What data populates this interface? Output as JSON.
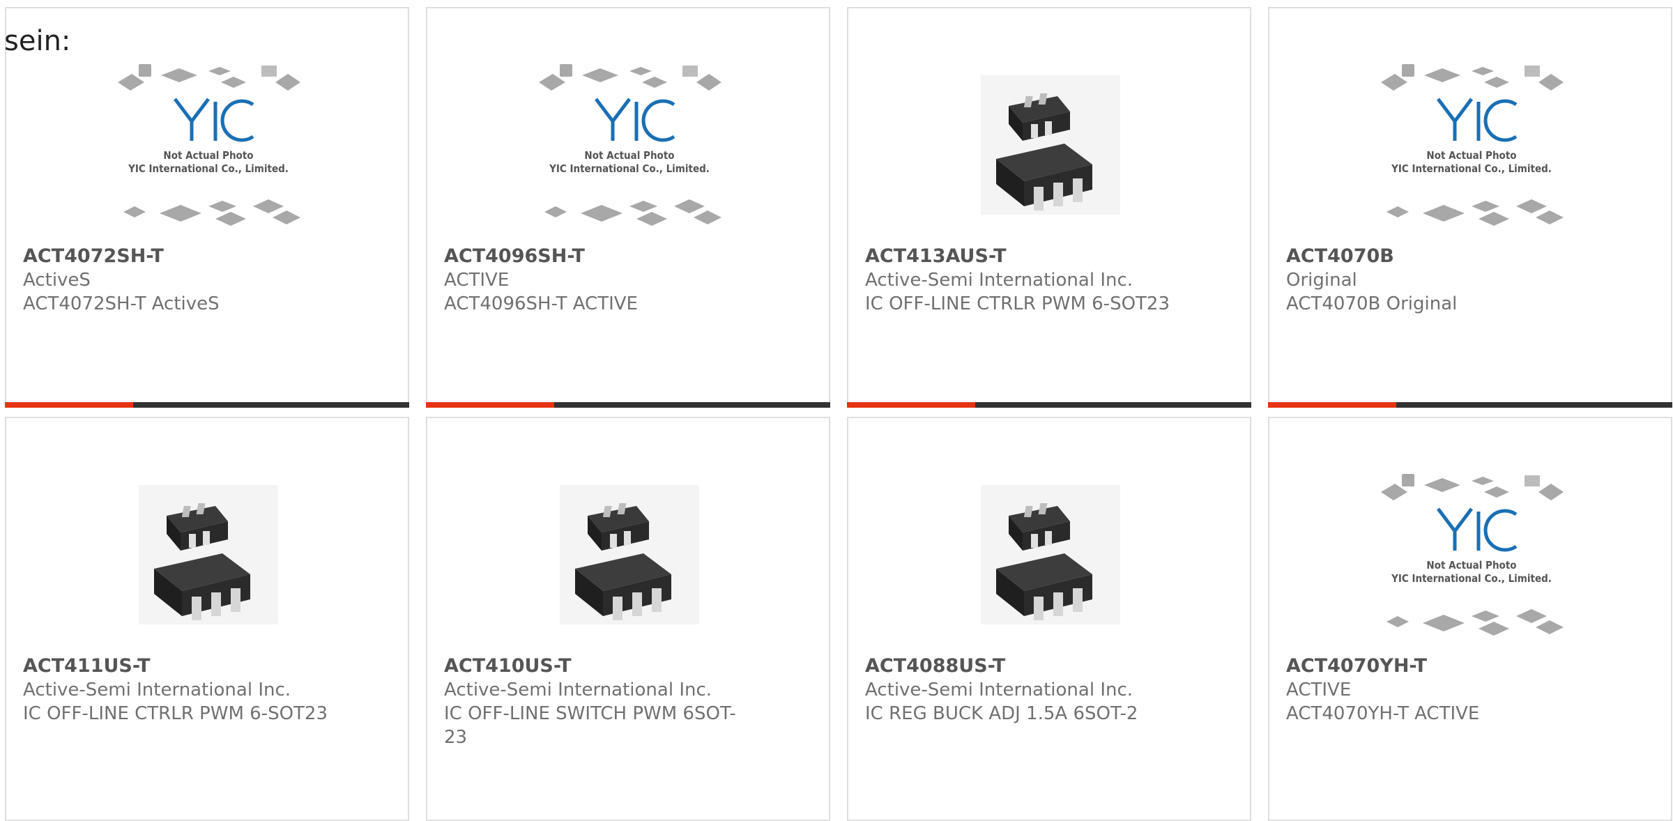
{
  "lead_text": "sein:",
  "colors": {
    "accent": "#e63312",
    "bar": "#333333"
  },
  "placeholder_image": {
    "caption_line1": "Not Actual Photo",
    "caption_line2": "YIC International Co., Limited.",
    "logo": "YIC"
  },
  "products": [
    {
      "part": "ACT4072SH-T",
      "maker": "ActiveS",
      "desc": "ACT4072SH-T ActiveS",
      "image": "placeholder",
      "accent_bar": true
    },
    {
      "part": "ACT4096SH-T",
      "maker": "ACTIVE",
      "desc": "ACT4096SH-T ACTIVE",
      "image": "placeholder",
      "accent_bar": true
    },
    {
      "part": "ACT413AUS-T",
      "maker": "Active-Semi International Inc.",
      "desc": "IC OFF-LINE CTRLR PWM 6-SOT23",
      "image": "sot23-chip",
      "accent_bar": true
    },
    {
      "part": "ACT4070B",
      "maker": "Original",
      "desc": "ACT4070B Original",
      "image": "placeholder",
      "accent_bar": true
    },
    {
      "part": "ACT411US-T",
      "maker": "Active-Semi International Inc.",
      "desc": "IC OFF-LINE CTRLR PWM 6-SOT23",
      "image": "sot23-chip",
      "accent_bar": false
    },
    {
      "part": "ACT410US-T",
      "maker": "Active-Semi International Inc.",
      "desc": "IC OFF-LINE SWITCH PWM 6SOT-23",
      "image": "sot23-chip",
      "accent_bar": false
    },
    {
      "part": "ACT4088US-T",
      "maker": "Active-Semi International Inc.",
      "desc": "IC REG BUCK ADJ 1.5A 6SOT-2",
      "image": "sot23-chip",
      "accent_bar": false
    },
    {
      "part": "ACT4070YH-T",
      "maker": "ACTIVE",
      "desc": "ACT4070YH-T ACTIVE",
      "image": "placeholder",
      "accent_bar": false
    }
  ]
}
